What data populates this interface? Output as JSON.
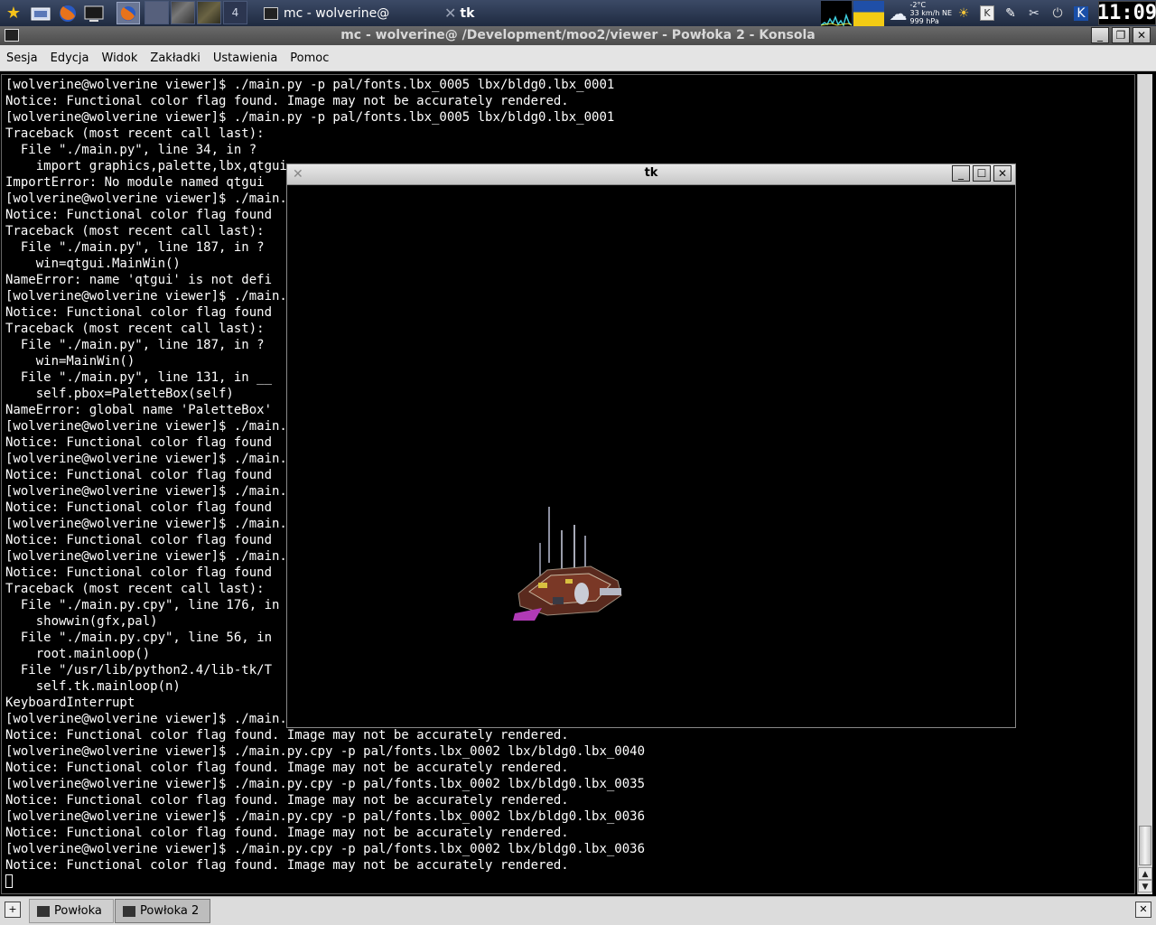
{
  "panel": {
    "pager_labels": [
      "",
      "",
      "",
      "4"
    ],
    "tasks": [
      {
        "label": "mc - wolverine@"
      },
      {
        "label": "tk"
      }
    ],
    "weather": {
      "temp": "-2°C",
      "wind": "33 km/h NE",
      "pressure": "999 hPa"
    },
    "clock": "11:09"
  },
  "konsole": {
    "title": "mc - wolverine@                       /Development/moo2/viewer - Powłoka 2 - Konsola",
    "menu": [
      "Sesja",
      "Edycja",
      "Widok",
      "Zakładki",
      "Ustawienia",
      "Pomoc"
    ],
    "lines": [
      "[wolverine@wolverine viewer]$ ./main.py -p pal/fonts.lbx_0005 lbx/bldg0.lbx_0001",
      "Notice: Functional color flag found. Image may not be accurately rendered.",
      "[wolverine@wolverine viewer]$ ./main.py -p pal/fonts.lbx_0005 lbx/bldg0.lbx_0001",
      "Traceback (most recent call last):",
      "  File \"./main.py\", line 34, in ?",
      "    import graphics,palette,lbx,qtgui",
      "ImportError: No module named qtgui",
      "[wolverine@wolverine viewer]$ ./main.py",
      "Notice: Functional color flag found",
      "Traceback (most recent call last):",
      "  File \"./main.py\", line 187, in ?",
      "    win=qtgui.MainWin()",
      "NameError: name 'qtgui' is not defi",
      "[wolverine@wolverine viewer]$ ./main.py",
      "Notice: Functional color flag found",
      "Traceback (most recent call last):",
      "  File \"./main.py\", line 187, in ?",
      "    win=MainWin()",
      "  File \"./main.py\", line 131, in __",
      "    self.pbox=PaletteBox(self)",
      "NameError: global name 'PaletteBox'",
      "[wolverine@wolverine viewer]$ ./main.py",
      "Notice: Functional color flag found",
      "[wolverine@wolverine viewer]$ ./main.py",
      "Notice: Functional color flag found",
      "[wolverine@wolverine viewer]$ ./main.py",
      "Notice: Functional color flag found",
      "[wolverine@wolverine viewer]$ ./main.py",
      "Notice: Functional color flag found",
      "[wolverine@wolverine viewer]$ ./main.py",
      "Notice: Functional color flag found",
      "Traceback (most recent call last):",
      "  File \"./main.py.cpy\", line 176, in",
      "    showwin(gfx,pal)",
      "  File \"./main.py.cpy\", line 56, in",
      "    root.mainloop()",
      "  File \"/usr/lib/python2.4/lib-tk/T",
      "    self.tk.mainloop(n)",
      "KeyboardInterrupt",
      "[wolverine@wolverine viewer]$ ./main.py",
      "Notice: Functional color flag found. Image may not be accurately rendered.",
      "[wolverine@wolverine viewer]$ ./main.py.cpy -p pal/fonts.lbx_0002 lbx/bldg0.lbx_0040",
      "Notice: Functional color flag found. Image may not be accurately rendered.",
      "[wolverine@wolverine viewer]$ ./main.py.cpy -p pal/fonts.lbx_0002 lbx/bldg0.lbx_0035",
      "Notice: Functional color flag found. Image may not be accurately rendered.",
      "[wolverine@wolverine viewer]$ ./main.py.cpy -p pal/fonts.lbx_0002 lbx/bldg0.lbx_0036",
      "Notice: Functional color flag found. Image may not be accurately rendered.",
      "[wolverine@wolverine viewer]$ ./main.py.cpy -p pal/fonts.lbx_0002 lbx/bldg0.lbx_0036",
      "Notice: Functional color flag found. Image may not be accurately rendered."
    ],
    "tabs": [
      {
        "label": "Powłoka"
      },
      {
        "label": "Powłoka 2"
      }
    ]
  },
  "tk_window": {
    "title": "tk"
  },
  "colors": {
    "terminal_bg": "#000000",
    "terminal_fg": "#ffffff",
    "menubar_bg": "#e4e4e4"
  }
}
